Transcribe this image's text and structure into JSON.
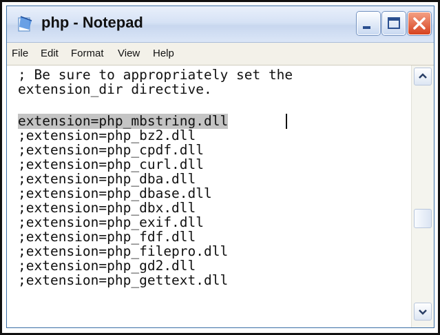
{
  "window": {
    "title": "php - Notepad"
  },
  "menu": [
    "File",
    "Edit",
    "Format",
    "View",
    "Help"
  ],
  "editor": {
    "lines": [
      "; Be sure to appropriately set the",
      "extension_dir directive.",
      "",
      "extension=php_mbstring.dll",
      ";extension=php_bz2.dll",
      ";extension=php_cpdf.dll",
      ";extension=php_curl.dll",
      ";extension=php_dba.dll",
      ";extension=php_dbase.dll",
      ";extension=php_dbx.dll",
      ";extension=php_exif.dll",
      ";extension=php_fdf.dll",
      ";extension=php_filepro.dll",
      ";extension=php_gd2.dll",
      ";extension=php_gettext.dll"
    ],
    "selected_line_index": 3
  },
  "icons": {
    "app": "notepad-icon",
    "minimize": "minimize-icon",
    "maximize": "maximize-icon",
    "close": "close-icon",
    "scroll_up": "chevron-up-icon",
    "scroll_down": "chevron-down-icon"
  },
  "colors": {
    "selection": "#c4c4c4",
    "close_button": "#d6421f",
    "titlebar": "#d6e2f5"
  }
}
